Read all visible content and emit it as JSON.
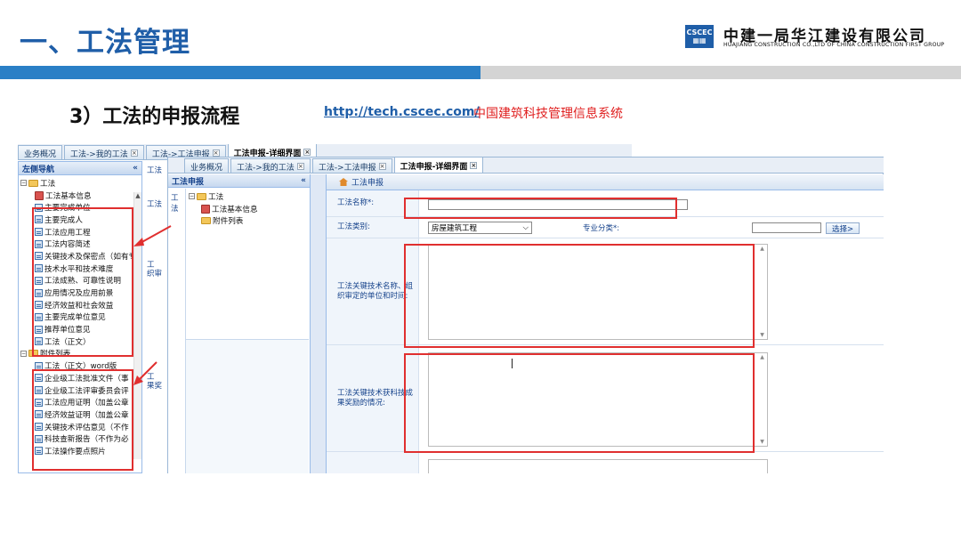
{
  "slide": {
    "title": "一、工法管理",
    "company_cn": "中建一局华江建设有限公司",
    "company_en": "HUAJIANG CONSTRUCTION CO.,LTD OF CHINA CONSTRUCTION FIRST GROUP",
    "subtitle": "3）工法的申报流程",
    "url": "http://tech.cscec.com/",
    "system_name": "中国建筑科技管理信息系统"
  },
  "back_window": {
    "tabs": [
      "业务概况",
      "工法->我的工法",
      "工法->工法申报",
      "工法申报-详细界面"
    ],
    "sidebar_title": "左侧导航",
    "collapse": "«",
    "tree_root": "工法",
    "tree_items": [
      "工法基本信息",
      "主要完成单位",
      "主要完成人",
      "工法应用工程",
      "工法内容简述",
      "关键技术及保密点（如有专利",
      "技术水平和技术难度",
      "工法成熟、可靠性说明",
      "应用情况及应用前景",
      "经济效益和社会效益",
      "主要完成单位意见",
      "推荐单位意见",
      "工法（正文）"
    ],
    "attach_root": "附件列表",
    "attach_items": [
      "工法（正文）word版",
      "企业级工法批准文件（事",
      "企业级工法评审委员会评",
      "工法应用证明（加盖公章",
      "经济效益证明（加盖公章",
      "关键技术评估意见（不作",
      "科技查新报告（不作为必",
      "工法操作要点照片"
    ],
    "strip_labels": [
      "工法",
      "工法",
      "工\n织审",
      "工\n果奖"
    ]
  },
  "front_window": {
    "tabs": [
      "业务概况",
      "工法->我的工法",
      "工法->工法申报",
      "工法申报-详细界面"
    ],
    "tab_close": "×",
    "left_panel_title": "工法申报",
    "left_strip_label": "工法",
    "tree_root": "工法",
    "tree_items": [
      "工法基本信息",
      "附件列表"
    ],
    "collapse": "«",
    "form_title": "工法申报",
    "fields": {
      "name_label": "工法名称*:",
      "name_value": "",
      "category_label": "工法类别:",
      "category_value": "房屋建筑工程",
      "specialty_label": "专业分类*:",
      "specialty_value": "",
      "pick_button": "选择>",
      "tech_label": "工法关键技术名称、组织审定的单位和时间:",
      "award_label": "工法关键技术获科技成果奖励的情况:"
    }
  }
}
